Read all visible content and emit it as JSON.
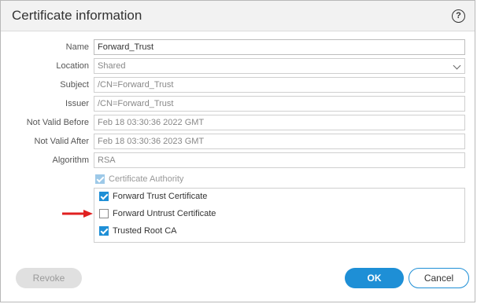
{
  "dialog": {
    "title": "Certificate information",
    "help_icon": "?"
  },
  "fields": [
    {
      "label": "Name",
      "value": "Forward_Trust"
    },
    {
      "label": "Location",
      "value": "Shared"
    },
    {
      "label": "Subject",
      "value": "/CN=Forward_Trust"
    },
    {
      "label": "Issuer",
      "value": "/CN=Forward_Trust"
    },
    {
      "label": "Not Valid Before",
      "value": "Feb 18 03:30:36 2022 GMT"
    },
    {
      "label": "Not Valid After",
      "value": "Feb 18 03:30:36 2023 GMT"
    },
    {
      "label": "Algorithm",
      "value": "RSA"
    }
  ],
  "certificate_authority": {
    "label": "Certificate Authority",
    "checked": true,
    "disabled": true
  },
  "options": [
    {
      "label": "Forward Trust Certificate",
      "checked": true
    },
    {
      "label": "Forward Untrust Certificate",
      "checked": false
    },
    {
      "label": "Trusted Root CA",
      "checked": true
    }
  ],
  "buttons": {
    "revoke": "Revoke",
    "ok": "OK",
    "cancel": "Cancel"
  },
  "colors": {
    "accent": "#1e8fd6",
    "annotation_arrow": "#e02020"
  }
}
